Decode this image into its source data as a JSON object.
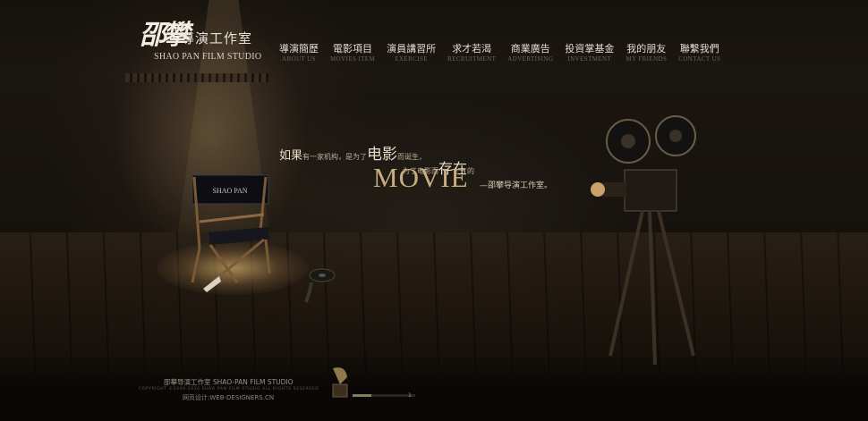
{
  "brand": {
    "logo_mark": "邵攀",
    "name_cn": "導演工作室",
    "name_en": "SHAO PAN FILM STUDIO"
  },
  "nav": {
    "items": [
      {
        "cn": "導演簡歷",
        "en": "ABOUT US"
      },
      {
        "cn": "電影項目",
        "en": "MOVIES ITEM"
      },
      {
        "cn": "演員講習所",
        "en": "EXERCISE"
      },
      {
        "cn": "求才若渴",
        "en": "RECRUITMENT"
      },
      {
        "cn": "商業廣告",
        "en": "ADVERTISING"
      },
      {
        "cn": "投資掌基金",
        "en": "INVESTMENT"
      },
      {
        "cn": "我的朋友",
        "en": "MY FRIENDS"
      },
      {
        "cn": "聯繫我們",
        "en": "CONTACT US"
      }
    ]
  },
  "hero": {
    "line1_a": "如果",
    "line1_b": "有一家机构，是为了",
    "line1_c": "电影",
    "line1_d": "而诞生，",
    "line2_a": "为了电影而",
    "line2_b": "存在",
    "line2_c": "的",
    "movie": "MOVIE",
    "movie_sub": "—邵攀导演工作室。",
    "chair_label": "SHAO PAN"
  },
  "footer": {
    "studio": "邵攀导演工作室 SHAO-PAN FILM STUDIO",
    "copyright": "COPYRIGHT ©2009-2010 SHAO PAN FILM STUDIO ALL RIGHTS RESERVED",
    "design": "网页设计:WEB-DESIGNERS.CN"
  },
  "player": {
    "prev_label": "◂◂",
    "next_label": "▸▸",
    "track_label": "1",
    "progress": 0.3
  },
  "colors": {
    "background": "#0a0806",
    "accent_gold": "#c8ad7e",
    "text_light": "#e0dacf"
  },
  "icons": [
    "director-chair-icon",
    "film-projector-icon",
    "film-reel-icon",
    "gramophone-icon",
    "megaphone-icon"
  ]
}
